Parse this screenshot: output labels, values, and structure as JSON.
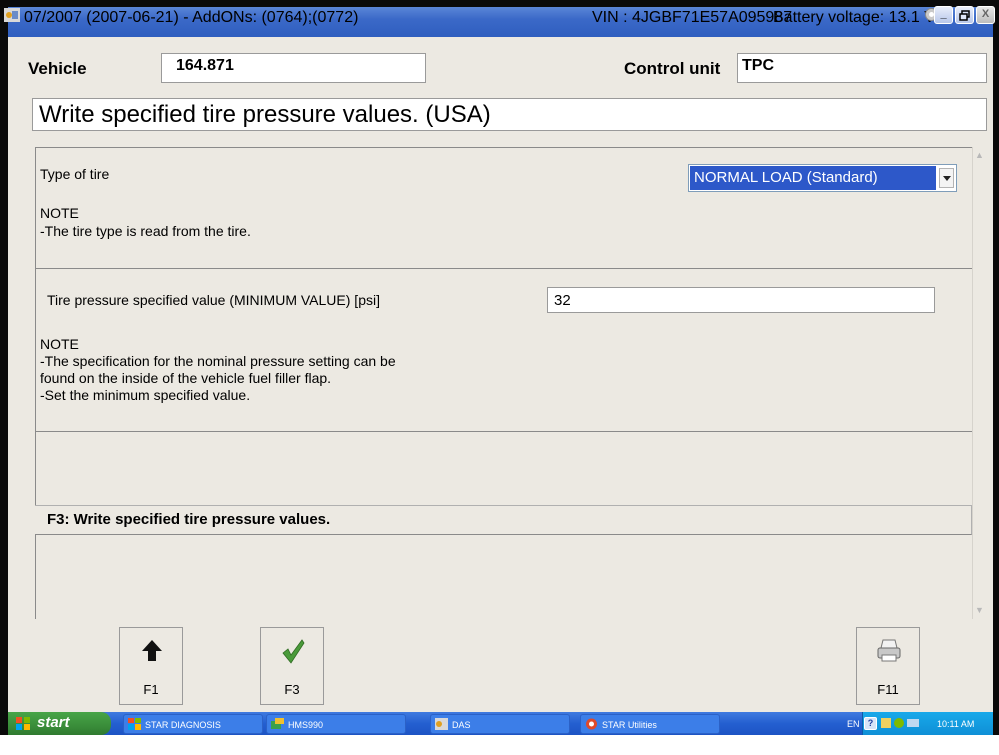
{
  "titlebar": {
    "title": "07/2007 (2007-06-21) - AddONs: (0764);(0772)",
    "vin": "VIN : 4JGBF71E57A095987",
    "battery": "Battery voltage: 13.1 V",
    "minimize": "_",
    "restore": "ő",
    "close": "X"
  },
  "header": {
    "vehicle_label": "Vehicle",
    "vehicle_value": "164.871",
    "control_unit_label": "Control unit",
    "control_unit_value": "TPC"
  },
  "heading": "Write specified tire pressure values. (USA)",
  "tire_type": {
    "label": "Type of tire",
    "selected": "NORMAL LOAD (Standard)",
    "note_title": "NOTE",
    "note_text": "-The tire type is read from the tire."
  },
  "pressure": {
    "label": "Tire pressure specified value (MINIMUM VALUE) [psi]",
    "value": "32",
    "note_title": "NOTE",
    "note_lines": [
      "-The specification for the nominal pressure setting can be",
      "found on the inside of the vehicle fuel filler flap.",
      "-Set the minimum specified value."
    ]
  },
  "f3_hint": "F3: Write specified tire pressure values.",
  "function_keys": [
    {
      "label": "F1",
      "icon": "up-arrow-icon"
    },
    {
      "label": "F3",
      "icon": "checkmark-icon"
    },
    {
      "label": "F11",
      "icon": "printer-icon"
    }
  ],
  "taskbar": {
    "start": "start",
    "tasks": [
      "STAR DIAGNOSIS",
      "HMS990",
      "DAS",
      "STAR Utilities"
    ],
    "language": "EN",
    "clock": "10:11 AM"
  },
  "colors": {
    "titlebar": "#3b69c8",
    "panel": "#ece9e2",
    "selection": "#2d58c9",
    "taskbar": "#245fd0",
    "start": "#3a8d3a"
  }
}
